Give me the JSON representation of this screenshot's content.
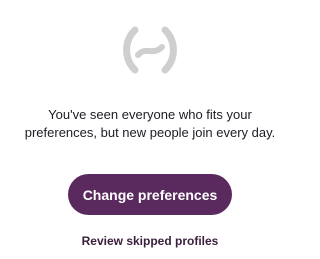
{
  "empty_state": {
    "icon": "empty-search-icon",
    "message_line1": "You've seen everyone who fits your",
    "message_line2": "preferences, but new people join every day."
  },
  "actions": {
    "primary_label": "Change preferences",
    "secondary_label": "Review skipped profiles"
  },
  "colors": {
    "primary_button": "#5a2a5e",
    "icon_gray": "#cfcfcf",
    "text": "#1e1b24"
  }
}
